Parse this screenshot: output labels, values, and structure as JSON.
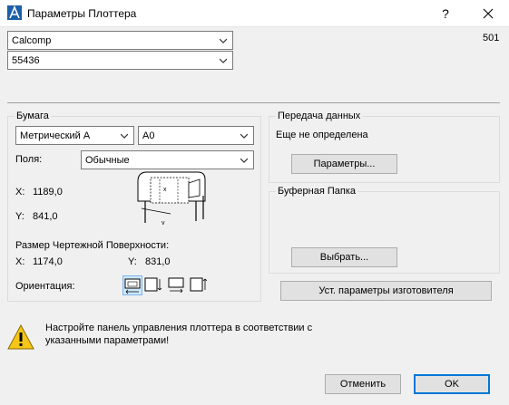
{
  "window": {
    "title": "Параметры Плоттера",
    "help_label": "?",
    "close_label": "✕"
  },
  "plotter": {
    "model": "Calcomp",
    "submodel": "55436",
    "code": "501"
  },
  "paper": {
    "group_title": "Бумага",
    "format_system": "Метрический A",
    "format_size": "A0",
    "margins_label": "Поля:",
    "margins_value": "Обычные",
    "x_label": "X:",
    "x_value": "1189,0",
    "y_label": "Y:",
    "y_value": "841,0",
    "drawing_area_label": "Размер Чертежной Поверхности:",
    "area_x_label": "X:",
    "area_x_value": "1174,0",
    "area_y_label": "Y:",
    "area_y_value": "831,0",
    "orientation_label": "Ориентация:"
  },
  "transfer": {
    "group_title": "Передача данных",
    "status": "Еще не определена",
    "params_button": "Параметры..."
  },
  "buffer": {
    "group_title": "Буферная Папка",
    "select_button": "Выбрать..."
  },
  "manufacturer_button": "Уст. параметры изготовителя",
  "warning_text_line1": "Настройте панель управления плоттера в соответствии с",
  "warning_text_line2": "указанными параметрами!",
  "footer": {
    "cancel_label": "Отменить",
    "ok_label": "OK"
  },
  "colors": {
    "accent": "#0078d7",
    "warning": "#f5c518"
  }
}
